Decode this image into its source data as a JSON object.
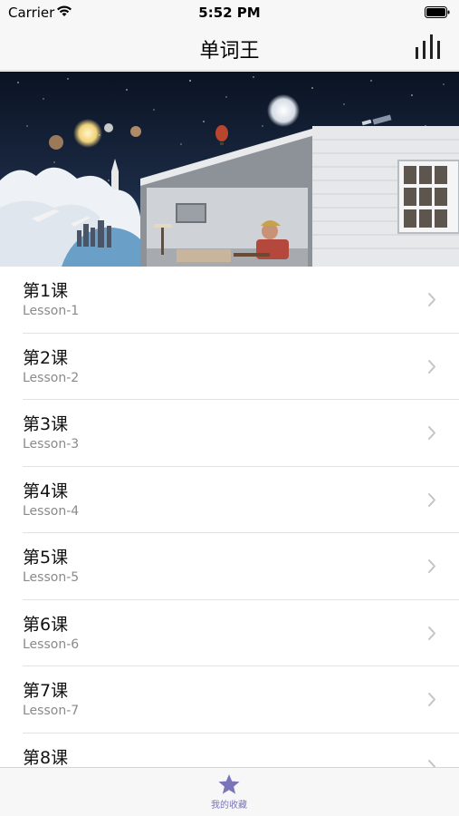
{
  "status_bar": {
    "carrier": "Carrier",
    "time": "5:52 PM"
  },
  "nav": {
    "title": "单词王",
    "right_icon": "bar-chart-icon"
  },
  "banner": {
    "description_icon": "space-house-illustration"
  },
  "lessons": [
    {
      "title": "第1课",
      "subtitle": "Lesson-1"
    },
    {
      "title": "第2课",
      "subtitle": "Lesson-2"
    },
    {
      "title": "第3课",
      "subtitle": "Lesson-3"
    },
    {
      "title": "第4课",
      "subtitle": "Lesson-4"
    },
    {
      "title": "第5课",
      "subtitle": "Lesson-5"
    },
    {
      "title": "第6课",
      "subtitle": "Lesson-6"
    },
    {
      "title": "第7课",
      "subtitle": "Lesson-7"
    },
    {
      "title": "第8课",
      "subtitle": ""
    }
  ],
  "tab_bar": {
    "favorites_label": "我的收藏",
    "favorites_icon": "star-icon",
    "accent_color": "#7a74b8"
  }
}
